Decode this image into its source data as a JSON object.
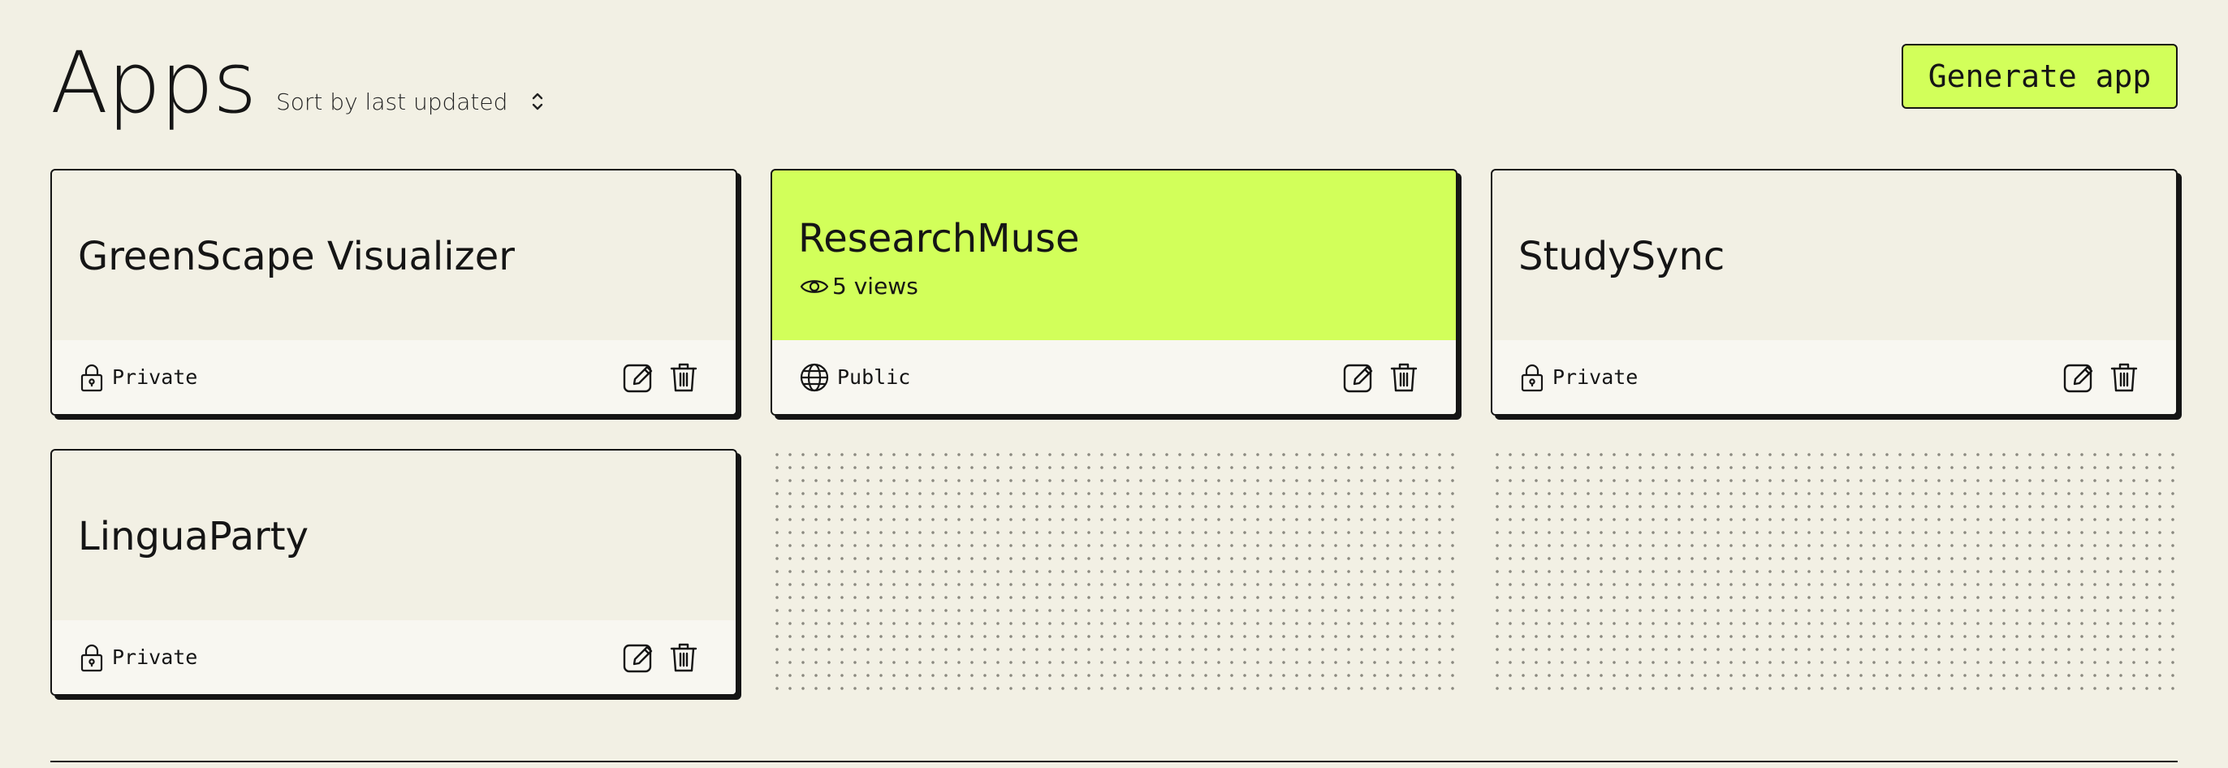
{
  "page": {
    "title": "Apps"
  },
  "sort": {
    "label": "Sort by last updated"
  },
  "header": {
    "generate_label": "Generate app"
  },
  "colors": {
    "accent": "#d2ff5a",
    "background": "#f2f0e4",
    "ink": "#151515"
  },
  "apps": [
    {
      "title": "GreenScape Visualizer",
      "visibility": "Private",
      "visibility_icon": "lock-icon"
    },
    {
      "title": "ResearchMuse",
      "views": "5 views",
      "visibility": "Public",
      "visibility_icon": "globe-icon",
      "highlighted": true
    },
    {
      "title": "StudySync",
      "visibility": "Private",
      "visibility_icon": "lock-icon"
    },
    {
      "title": "LinguaParty",
      "visibility": "Private",
      "visibility_icon": "lock-icon"
    }
  ]
}
